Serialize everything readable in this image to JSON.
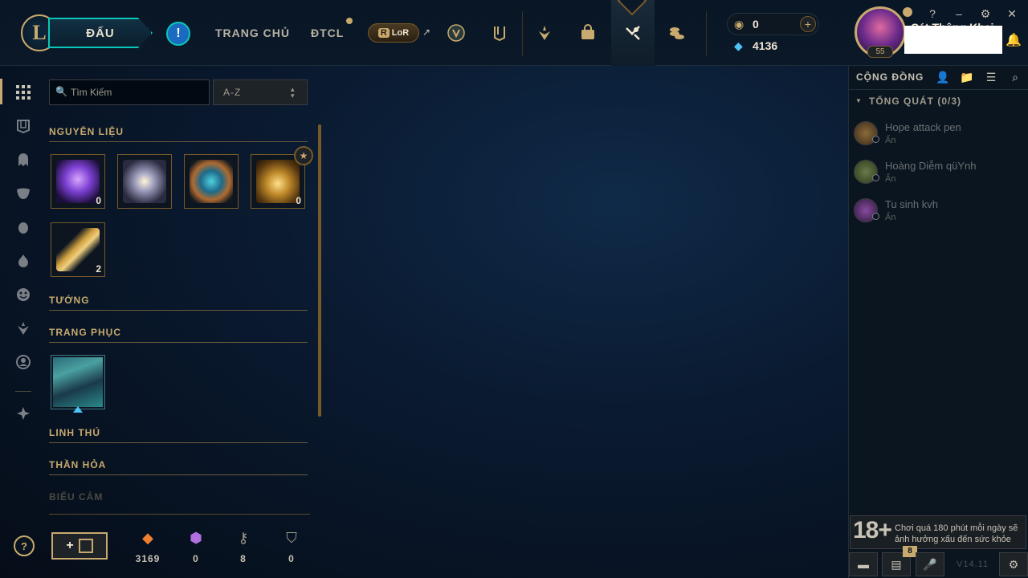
{
  "header": {
    "play_label": "ĐẤU",
    "nav": [
      "TRANG CHỦ",
      "ĐTCL"
    ],
    "lor_label": "LoR",
    "lor_icon_letter": "R",
    "lor_arrow": "↗",
    "icons": [
      "clash-icon",
      "collection-icon",
      "tft-icon",
      "store-icon",
      "loot-icon",
      "currency-icon"
    ]
  },
  "currency": {
    "rp": "0",
    "be": "4136",
    "rp_icon": "rp-icon",
    "be_icon": "blue-essence-icon",
    "plus": "+"
  },
  "profile": {
    "level": "55",
    "name": "Cát Thông Khai"
  },
  "window_controls": {
    "help": "?",
    "minimize": "–",
    "settings": "⚙",
    "close": "✕"
  },
  "loot": {
    "search_placeholder": "Tìm Kiếm",
    "sort_value": "A-Z",
    "sections": {
      "materials": "NGUYÊN LIỆU",
      "champions": "TƯỚNG",
      "skins": "TRANG PHỤC",
      "pets": "LINH THÚ",
      "wards": "THẦN HỎA",
      "emotes": "BIỂU CẢM"
    },
    "materials": [
      {
        "name": "mythic-essence",
        "count": "0"
      },
      {
        "name": "orb",
        "count": ""
      },
      {
        "name": "capsule",
        "count": ""
      },
      {
        "name": "masterwork-chest",
        "count": "0"
      },
      {
        "name": "hextech-key",
        "count": "2"
      }
    ]
  },
  "footer_materials": [
    {
      "icon": "orange-essence-icon",
      "value": "3169",
      "color": "#f08030"
    },
    {
      "icon": "mythic-essence-icon",
      "value": "0",
      "color": "#b070e0"
    },
    {
      "icon": "key-fragment-icon",
      "value": "8",
      "color": "#a09b8c"
    },
    {
      "icon": "loot-icon",
      "value": "0",
      "color": "#a09b8c"
    }
  ],
  "social": {
    "title": "CỘNG ĐỒNG",
    "group": "TỔNG QUÁT (0/3)",
    "friends": [
      {
        "name": "Hope attack pen",
        "status": "Ẩn"
      },
      {
        "name": "Hoàng Diễm qüYnh",
        "status": "Ẩn"
      },
      {
        "name": "Tu sinh kvh",
        "status": "Ẩn"
      }
    ]
  },
  "age_notice": {
    "badge": "18+",
    "text": "Chơi quá 180 phút mỗi ngày sẽ ảnh hưởng xấu đến sức khỏe"
  },
  "footer": {
    "missions_count": "8",
    "version": "V14.11"
  },
  "colors": {
    "gold": "#c8aa6e",
    "teal": "#0ac8b9",
    "bg": "#0a1a30"
  }
}
